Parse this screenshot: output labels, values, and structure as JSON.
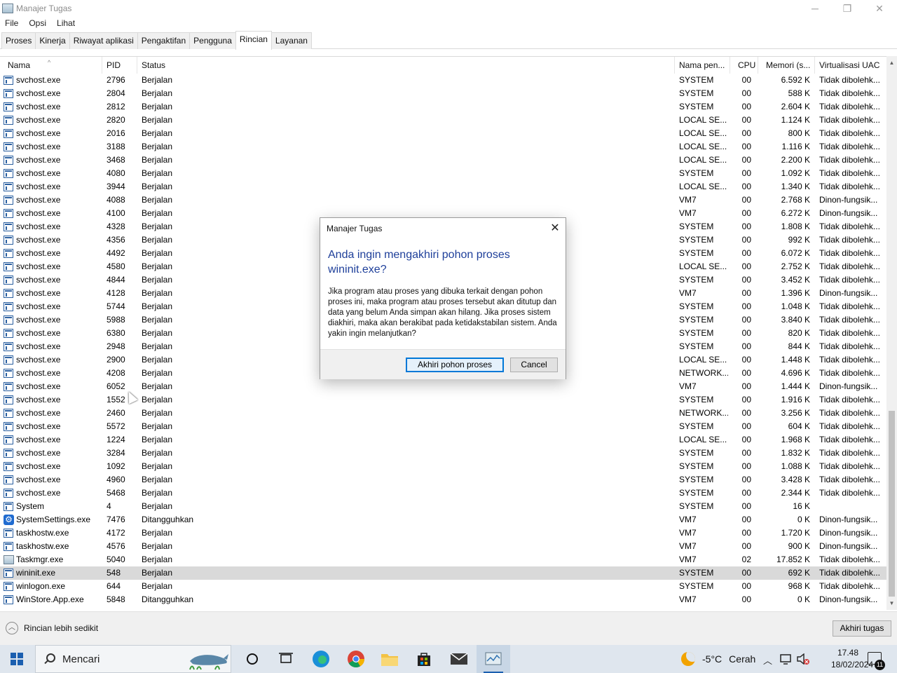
{
  "window": {
    "title": "Manajer Tugas",
    "minimize": "─",
    "maximize": "❐",
    "close": "✕"
  },
  "menu": [
    "File",
    "Opsi",
    "Lihat"
  ],
  "tabs": [
    "Proses",
    "Kinerja",
    "Riwayat aplikasi",
    "Pengaktifan",
    "Pengguna",
    "Rincian",
    "Layanan"
  ],
  "active_tab": "Rincian",
  "columns": {
    "name": "Nama",
    "pid": "PID",
    "status": "Status",
    "user": "Nama pen...",
    "cpu": "CPU",
    "memory": "Memori (s...",
    "uac": "Virtualisasi UAC",
    "sort_indicator": "^"
  },
  "rows": [
    {
      "name": "svchost.exe",
      "pid": "2796",
      "status": "Berjalan",
      "user": "SYSTEM",
      "cpu": "00",
      "memory": "6.592 K",
      "uac": "Tidak dibolehk..."
    },
    {
      "name": "svchost.exe",
      "pid": "2804",
      "status": "Berjalan",
      "user": "SYSTEM",
      "cpu": "00",
      "memory": "588 K",
      "uac": "Tidak dibolehk..."
    },
    {
      "name": "svchost.exe",
      "pid": "2812",
      "status": "Berjalan",
      "user": "SYSTEM",
      "cpu": "00",
      "memory": "2.604 K",
      "uac": "Tidak dibolehk..."
    },
    {
      "name": "svchost.exe",
      "pid": "2820",
      "status": "Berjalan",
      "user": "LOCAL SE...",
      "cpu": "00",
      "memory": "1.124 K",
      "uac": "Tidak dibolehk..."
    },
    {
      "name": "svchost.exe",
      "pid": "2016",
      "status": "Berjalan",
      "user": "LOCAL SE...",
      "cpu": "00",
      "memory": "800 K",
      "uac": "Tidak dibolehk..."
    },
    {
      "name": "svchost.exe",
      "pid": "3188",
      "status": "Berjalan",
      "user": "LOCAL SE...",
      "cpu": "00",
      "memory": "1.116 K",
      "uac": "Tidak dibolehk..."
    },
    {
      "name": "svchost.exe",
      "pid": "3468",
      "status": "Berjalan",
      "user": "LOCAL SE...",
      "cpu": "00",
      "memory": "2.200 K",
      "uac": "Tidak dibolehk..."
    },
    {
      "name": "svchost.exe",
      "pid": "4080",
      "status": "Berjalan",
      "user": "SYSTEM",
      "cpu": "00",
      "memory": "1.092 K",
      "uac": "Tidak dibolehk..."
    },
    {
      "name": "svchost.exe",
      "pid": "3944",
      "status": "Berjalan",
      "user": "LOCAL SE...",
      "cpu": "00",
      "memory": "1.340 K",
      "uac": "Tidak dibolehk..."
    },
    {
      "name": "svchost.exe",
      "pid": "4088",
      "status": "Berjalan",
      "user": "VM7",
      "cpu": "00",
      "memory": "2.768 K",
      "uac": "Dinon-fungsik..."
    },
    {
      "name": "svchost.exe",
      "pid": "4100",
      "status": "Berjalan",
      "user": "VM7",
      "cpu": "00",
      "memory": "6.272 K",
      "uac": "Dinon-fungsik..."
    },
    {
      "name": "svchost.exe",
      "pid": "4328",
      "status": "Berjalan",
      "user": "SYSTEM",
      "cpu": "00",
      "memory": "1.808 K",
      "uac": "Tidak dibolehk..."
    },
    {
      "name": "svchost.exe",
      "pid": "4356",
      "status": "Berjalan",
      "user": "SYSTEM",
      "cpu": "00",
      "memory": "992 K",
      "uac": "Tidak dibolehk..."
    },
    {
      "name": "svchost.exe",
      "pid": "4492",
      "status": "Berjalan",
      "user": "SYSTEM",
      "cpu": "00",
      "memory": "6.072 K",
      "uac": "Tidak dibolehk..."
    },
    {
      "name": "svchost.exe",
      "pid": "4580",
      "status": "Berjalan",
      "user": "LOCAL SE...",
      "cpu": "00",
      "memory": "2.752 K",
      "uac": "Tidak dibolehk..."
    },
    {
      "name": "svchost.exe",
      "pid": "4844",
      "status": "Berjalan",
      "user": "SYSTEM",
      "cpu": "00",
      "memory": "3.452 K",
      "uac": "Tidak dibolehk..."
    },
    {
      "name": "svchost.exe",
      "pid": "4128",
      "status": "Berjalan",
      "user": "VM7",
      "cpu": "00",
      "memory": "1.396 K",
      "uac": "Dinon-fungsik..."
    },
    {
      "name": "svchost.exe",
      "pid": "5744",
      "status": "Berjalan",
      "user": "SYSTEM",
      "cpu": "00",
      "memory": "1.048 K",
      "uac": "Tidak dibolehk..."
    },
    {
      "name": "svchost.exe",
      "pid": "5988",
      "status": "Berjalan",
      "user": "SYSTEM",
      "cpu": "00",
      "memory": "3.840 K",
      "uac": "Tidak dibolehk..."
    },
    {
      "name": "svchost.exe",
      "pid": "6380",
      "status": "Berjalan",
      "user": "SYSTEM",
      "cpu": "00",
      "memory": "820 K",
      "uac": "Tidak dibolehk..."
    },
    {
      "name": "svchost.exe",
      "pid": "2948",
      "status": "Berjalan",
      "user": "SYSTEM",
      "cpu": "00",
      "memory": "844 K",
      "uac": "Tidak dibolehk..."
    },
    {
      "name": "svchost.exe",
      "pid": "2900",
      "status": "Berjalan",
      "user": "LOCAL SE...",
      "cpu": "00",
      "memory": "1.448 K",
      "uac": "Tidak dibolehk..."
    },
    {
      "name": "svchost.exe",
      "pid": "4208",
      "status": "Berjalan",
      "user": "NETWORK...",
      "cpu": "00",
      "memory": "4.696 K",
      "uac": "Tidak dibolehk..."
    },
    {
      "name": "svchost.exe",
      "pid": "6052",
      "status": "Berjalan",
      "user": "VM7",
      "cpu": "00",
      "memory": "1.444 K",
      "uac": "Dinon-fungsik..."
    },
    {
      "name": "svchost.exe",
      "pid": "1552",
      "status": "Berjalan",
      "user": "SYSTEM",
      "cpu": "00",
      "memory": "1.916 K",
      "uac": "Tidak dibolehk..."
    },
    {
      "name": "svchost.exe",
      "pid": "2460",
      "status": "Berjalan",
      "user": "NETWORK...",
      "cpu": "00",
      "memory": "3.256 K",
      "uac": "Tidak dibolehk..."
    },
    {
      "name": "svchost.exe",
      "pid": "5572",
      "status": "Berjalan",
      "user": "SYSTEM",
      "cpu": "00",
      "memory": "604 K",
      "uac": "Tidak dibolehk..."
    },
    {
      "name": "svchost.exe",
      "pid": "1224",
      "status": "Berjalan",
      "user": "LOCAL SE...",
      "cpu": "00",
      "memory": "1.968 K",
      "uac": "Tidak dibolehk..."
    },
    {
      "name": "svchost.exe",
      "pid": "3284",
      "status": "Berjalan",
      "user": "SYSTEM",
      "cpu": "00",
      "memory": "1.832 K",
      "uac": "Tidak dibolehk..."
    },
    {
      "name": "svchost.exe",
      "pid": "1092",
      "status": "Berjalan",
      "user": "SYSTEM",
      "cpu": "00",
      "memory": "1.088 K",
      "uac": "Tidak dibolehk..."
    },
    {
      "name": "svchost.exe",
      "pid": "4960",
      "status": "Berjalan",
      "user": "SYSTEM",
      "cpu": "00",
      "memory": "3.428 K",
      "uac": "Tidak dibolehk..."
    },
    {
      "name": "svchost.exe",
      "pid": "5468",
      "status": "Berjalan",
      "user": "SYSTEM",
      "cpu": "00",
      "memory": "2.344 K",
      "uac": "Tidak dibolehk..."
    },
    {
      "name": "System",
      "pid": "4",
      "status": "Berjalan",
      "user": "SYSTEM",
      "cpu": "00",
      "memory": "16 K",
      "uac": ""
    },
    {
      "name": "SystemSettings.exe",
      "pid": "7476",
      "status": "Ditangguhkan",
      "user": "VM7",
      "cpu": "00",
      "memory": "0 K",
      "uac": "Dinon-fungsik...",
      "icon": "gear"
    },
    {
      "name": "taskhostw.exe",
      "pid": "4172",
      "status": "Berjalan",
      "user": "VM7",
      "cpu": "00",
      "memory": "1.720 K",
      "uac": "Dinon-fungsik..."
    },
    {
      "name": "taskhostw.exe",
      "pid": "4576",
      "status": "Berjalan",
      "user": "VM7",
      "cpu": "00",
      "memory": "900 K",
      "uac": "Dinon-fungsik..."
    },
    {
      "name": "Taskmgr.exe",
      "pid": "5040",
      "status": "Berjalan",
      "user": "VM7",
      "cpu": "02",
      "memory": "17.852 K",
      "uac": "Tidak dibolehk...",
      "icon": "taskmgr"
    },
    {
      "name": "wininit.exe",
      "pid": "548",
      "status": "Berjalan",
      "user": "SYSTEM",
      "cpu": "00",
      "memory": "692 K",
      "uac": "Tidak dibolehk...",
      "selected": true
    },
    {
      "name": "winlogon.exe",
      "pid": "644",
      "status": "Berjalan",
      "user": "SYSTEM",
      "cpu": "00",
      "memory": "968 K",
      "uac": "Tidak dibolehk..."
    },
    {
      "name": "WinStore.App.exe",
      "pid": "5848",
      "status": "Ditangguhkan",
      "user": "VM7",
      "cpu": "00",
      "memory": "0 K",
      "uac": "Dinon-fungsik..."
    }
  ],
  "footer": {
    "fewer_details": "Rincian lebih sedikit",
    "end_task": "Akhiri tugas"
  },
  "dialog": {
    "title": "Manajer Tugas",
    "heading": "Anda ingin mengakhiri pohon proses wininit.exe?",
    "body": "Jika program atau proses yang dibuka terkait dengan pohon proses ini, maka program atau proses tersebut akan ditutup dan data yang belum Anda simpan akan hilang. Jika proses sistem diakhiri, maka akan berakibat pada ketidakstabilan sistem. Anda yakin ingin melanjutkan?",
    "confirm": "Akhiri pohon proses",
    "cancel": "Cancel"
  },
  "taskbar": {
    "search_placeholder": "Mencari",
    "weather_temp": "-5°C",
    "weather_desc": "Cerah",
    "time": "17.48",
    "date": "18/02/2024",
    "notification_count": "11"
  },
  "colors": {
    "accent": "#0078d7",
    "heading_blue": "#1e3f9a",
    "selected_row": "#d9d9d9"
  }
}
